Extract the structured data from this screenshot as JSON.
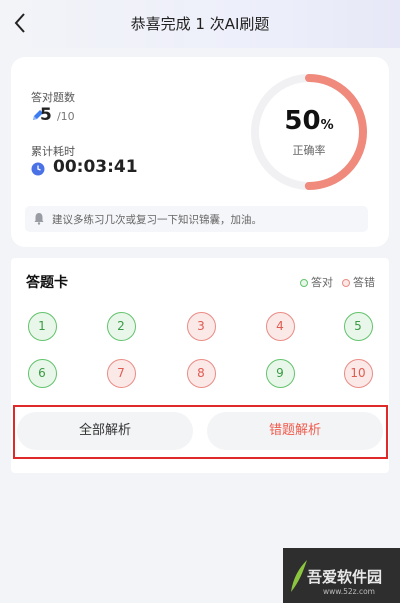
{
  "header": {
    "title": "恭喜完成 1 次AI刷题"
  },
  "summary": {
    "correct_label": "答对题数",
    "correct_count": "5",
    "total_count": "/10",
    "time_label": "累计耗时",
    "time_value": "00:03:41",
    "accuracy_value": "50",
    "accuracy_unit": "%",
    "accuracy_fraction": 0.5,
    "accuracy_label": "正确率",
    "tip": "建议多练习几次或复习一下知识锦囊，加油。"
  },
  "answer_card": {
    "title": "答题卡",
    "legend_correct": "答对",
    "legend_wrong": "答错",
    "questions": [
      {
        "number": "1",
        "status": "correct"
      },
      {
        "number": "2",
        "status": "correct"
      },
      {
        "number": "3",
        "status": "wrong"
      },
      {
        "number": "4",
        "status": "wrong"
      },
      {
        "number": "5",
        "status": "correct"
      },
      {
        "number": "6",
        "status": "correct"
      },
      {
        "number": "7",
        "status": "wrong"
      },
      {
        "number": "8",
        "status": "wrong"
      },
      {
        "number": "9",
        "status": "correct"
      },
      {
        "number": "10",
        "status": "wrong"
      }
    ]
  },
  "actions": {
    "all_analysis": "全部解析",
    "wrong_analysis": "错题解析"
  },
  "watermark": {
    "text": "吾爱软件园",
    "url": "www.52z.com"
  },
  "colors": {
    "accent_red": "#ef8a7c",
    "correct_green": "#63c36d",
    "wrong_red": "#ea8c85",
    "highlight_frame": "#e02a2a"
  }
}
